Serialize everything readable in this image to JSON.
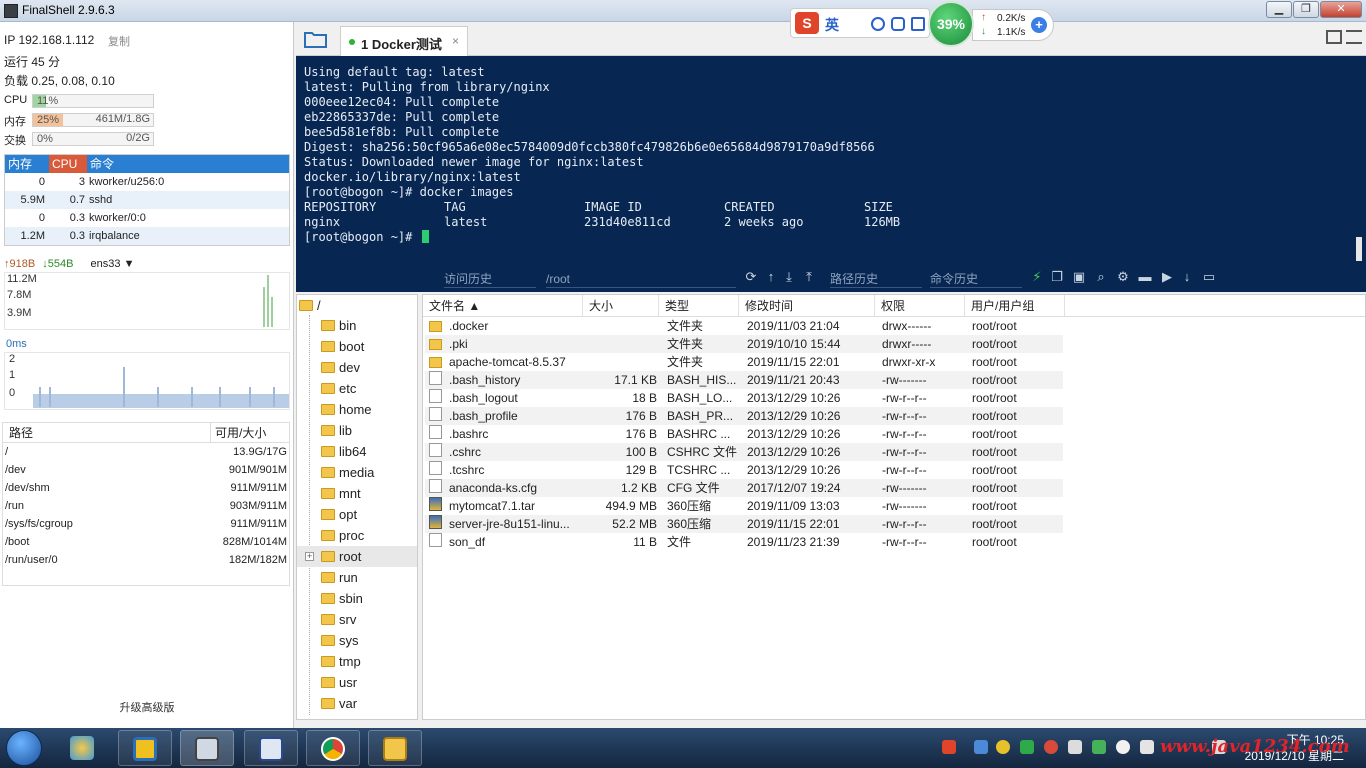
{
  "window": {
    "title": "FinalShell 2.9.6.3"
  },
  "left": {
    "ip": "IP 192.168.1.112",
    "copy": "复制",
    "uptime": "运行 45 分",
    "load": "负载 0.25, 0.08, 0.10",
    "cpu": {
      "label": "CPU",
      "pct": "11%",
      "value": 0.11
    },
    "mem": {
      "label": "内存",
      "pct": "25%",
      "value": 0.25,
      "detail": "461M/1.8G"
    },
    "swap": {
      "label": "交换",
      "pct": "0%",
      "value": 0,
      "detail": "0/2G"
    },
    "proc_headers": [
      "内存",
      "CPU",
      "命令"
    ],
    "procs": [
      {
        "mem": "0",
        "cpu": "3",
        "cmd": "kworker/u256:0"
      },
      {
        "mem": "5.9M",
        "cpu": "0.7",
        "cmd": "sshd"
      },
      {
        "mem": "0",
        "cpu": "0.3",
        "cmd": "kworker/0:0"
      },
      {
        "mem": "1.2M",
        "cpu": "0.3",
        "cmd": "irqbalance"
      }
    ],
    "net": {
      "up": "918B",
      "down": "554B",
      "iface": "ens33",
      "scale": [
        "11.2M",
        "7.8M",
        "3.9M"
      ]
    },
    "latency": {
      "label": "0ms",
      "scale": [
        "2",
        "1",
        "0"
      ]
    },
    "fs_headers": {
      "path": "路径",
      "size": "可用/大小"
    },
    "fs": [
      {
        "path": "/",
        "size": "13.9G/17G"
      },
      {
        "path": "/dev",
        "size": "901M/901M"
      },
      {
        "path": "/dev/shm",
        "size": "911M/911M"
      },
      {
        "path": "/run",
        "size": "903M/911M"
      },
      {
        "path": "/sys/fs/cgroup",
        "size": "911M/911M"
      },
      {
        "path": "/boot",
        "size": "828M/1014M"
      },
      {
        "path": "/run/user/0",
        "size": "182M/182M"
      }
    ],
    "upgrade": "升级高级版"
  },
  "tab": {
    "label": "1 Docker测试",
    "close": "×"
  },
  "overlay": {
    "ime_lang": "英",
    "cpu_ball": "39%",
    "up_rate": "0.2K/s",
    "down_rate": "1.1K/s"
  },
  "terminal": {
    "lines": [
      "Using default tag: latest",
      "latest: Pulling from library/nginx",
      "000eee12ec04: Pull complete",
      "eb22865337de: Pull complete",
      "bee5d581ef8b: Pull complete",
      "Digest: sha256:50cf965a6e08ec5784009d0fccb380fc479826b6e0e65684d9879170a9df8566",
      "Status: Downloaded newer image for nginx:latest",
      "docker.io/library/nginx:latest",
      "[root@bogon ~]# docker images"
    ],
    "table_head": [
      "REPOSITORY",
      "TAG",
      "IMAGE ID",
      "CREATED",
      "SIZE"
    ],
    "table_row": [
      "nginx",
      "latest",
      "231d40e811cd",
      "2 weeks ago",
      "126MB"
    ],
    "prompt": "[root@bogon ~]# "
  },
  "toolbar": {
    "history": "访问历史",
    "path": "/root",
    "path_history": "路径历史",
    "cmd_history": "命令历史"
  },
  "tree": {
    "root": "/",
    "items": [
      "bin",
      "boot",
      "dev",
      "etc",
      "home",
      "lib",
      "lib64",
      "media",
      "mnt",
      "opt",
      "proc",
      "root",
      "run",
      "sbin",
      "srv",
      "sys",
      "tmp",
      "usr",
      "var"
    ]
  },
  "files": {
    "headers": [
      "文件名 ▲",
      "大小",
      "类型",
      "修改时间",
      "权限",
      "用户/用户组"
    ],
    "rows": [
      {
        "name": ".docker",
        "size": "",
        "type": "文件夹",
        "mtime": "2019/11/03 21:04",
        "perm": "drwx------",
        "owner": "root/root",
        "icon": "dir"
      },
      {
        "name": ".pki",
        "size": "",
        "type": "文件夹",
        "mtime": "2019/10/10 15:44",
        "perm": "drwxr-----",
        "owner": "root/root",
        "icon": "dir"
      },
      {
        "name": "apache-tomcat-8.5.37",
        "size": "",
        "type": "文件夹",
        "mtime": "2019/11/15 22:01",
        "perm": "drwxr-xr-x",
        "owner": "root/root",
        "icon": "dir"
      },
      {
        "name": ".bash_history",
        "size": "17.1 KB",
        "type": "BASH_HIS...",
        "mtime": "2019/11/21 20:43",
        "perm": "-rw-------",
        "owner": "root/root",
        "icon": "doc"
      },
      {
        "name": ".bash_logout",
        "size": "18 B",
        "type": "BASH_LO...",
        "mtime": "2013/12/29 10:26",
        "perm": "-rw-r--r--",
        "owner": "root/root",
        "icon": "doc"
      },
      {
        "name": ".bash_profile",
        "size": "176 B",
        "type": "BASH_PR...",
        "mtime": "2013/12/29 10:26",
        "perm": "-rw-r--r--",
        "owner": "root/root",
        "icon": "doc"
      },
      {
        "name": ".bashrc",
        "size": "176 B",
        "type": "BASHRC ...",
        "mtime": "2013/12/29 10:26",
        "perm": "-rw-r--r--",
        "owner": "root/root",
        "icon": "doc"
      },
      {
        "name": ".cshrc",
        "size": "100 B",
        "type": "CSHRC 文件",
        "mtime": "2013/12/29 10:26",
        "perm": "-rw-r--r--",
        "owner": "root/root",
        "icon": "doc"
      },
      {
        "name": ".tcshrc",
        "size": "129 B",
        "type": "TCSHRC ...",
        "mtime": "2013/12/29 10:26",
        "perm": "-rw-r--r--",
        "owner": "root/root",
        "icon": "doc"
      },
      {
        "name": "anaconda-ks.cfg",
        "size": "1.2 KB",
        "type": "CFG 文件",
        "mtime": "2017/12/07 19:24",
        "perm": "-rw-------",
        "owner": "root/root",
        "icon": "doc"
      },
      {
        "name": "mytomcat7.1.tar",
        "size": "494.9 MB",
        "type": "360压缩",
        "mtime": "2019/11/09 13:03",
        "perm": "-rw-------",
        "owner": "root/root",
        "icon": "arc"
      },
      {
        "name": "server-jre-8u151-linu...",
        "size": "52.2 MB",
        "type": "360压缩",
        "mtime": "2019/11/15 22:01",
        "perm": "-rw-r--r--",
        "owner": "root/root",
        "icon": "arc"
      },
      {
        "name": "son_df",
        "size": "11 B",
        "type": "文件",
        "mtime": "2019/11/23 21:39",
        "perm": "-rw-r--r--",
        "owner": "root/root",
        "icon": "doc"
      }
    ]
  },
  "taskbar": {
    "time": "下午 10:25",
    "date": "2019/12/10 星期二",
    "watermark": "www.java1234.com"
  }
}
